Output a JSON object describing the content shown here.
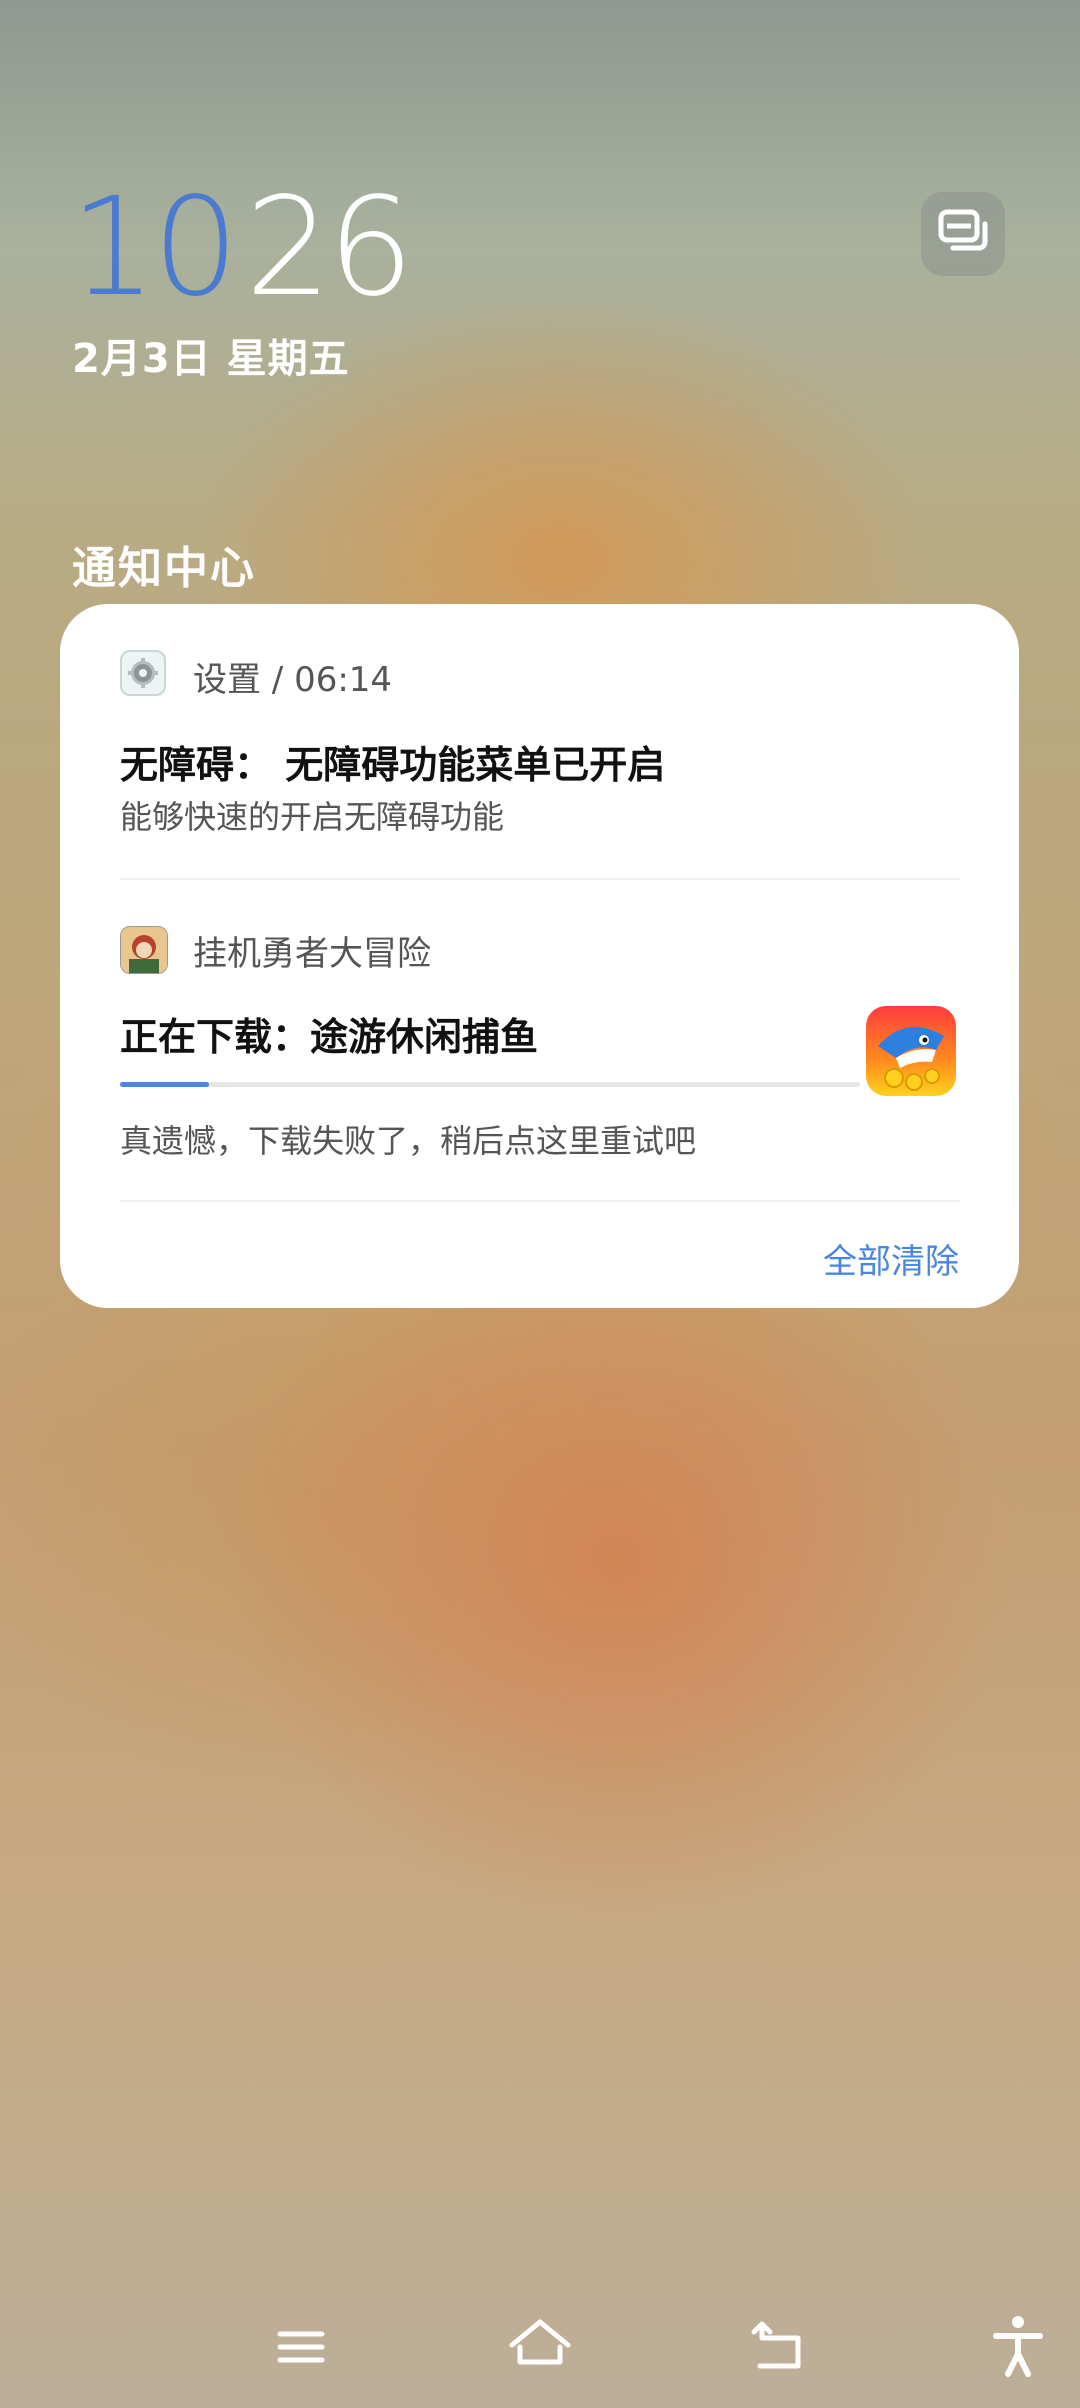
{
  "lockscreen": {
    "clock_hour": "10",
    "clock_minute": "26",
    "date": "2月3日 星期五"
  },
  "notification_center": {
    "title": "通知中心",
    "clear_all_label": "全部清除",
    "notifications": [
      {
        "app_name": "设置",
        "app_time": "设置 / 06:14",
        "icon": "gear-icon",
        "title": "无障碍：  无障碍功能菜单已开启",
        "body": "能够快速的开启无障碍功能"
      },
      {
        "app_name": "挂机勇者大冒险",
        "icon": "game-avatar-icon",
        "title": "正在下载：途游休闲捕鱼",
        "progress": 0.12,
        "body": "真遗憾，下载失败了，稍后点这里重试吧",
        "thumbnail": "fishing-game-icon"
      }
    ]
  },
  "navbar": {
    "buttons": [
      "menu-icon",
      "home-icon",
      "back-icon",
      "accessibility-icon"
    ]
  },
  "colors": {
    "clock_hour": "#4a7bd0",
    "accent": "#4a86e0"
  }
}
